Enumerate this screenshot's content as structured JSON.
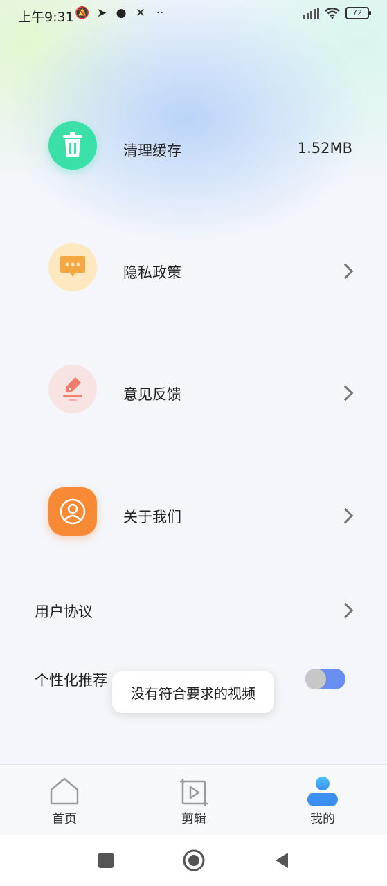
{
  "status_bar": {
    "time": "上午9:31",
    "battery": "72",
    "left_icons": [
      "muted-bell-icon",
      "telegram-icon",
      "chat-bubble-icon",
      "app-icon",
      "more-dots-icon"
    ]
  },
  "menu": {
    "items": [
      {
        "label": "清理缓存",
        "value": "1.52MB",
        "icon": "trash-icon",
        "color": "#3be0a8"
      },
      {
        "label": "隐私政策",
        "icon": "message-dots-icon",
        "color": "#f5a742"
      },
      {
        "label": "意见反馈",
        "icon": "pen-feedback-icon",
        "color": "#f07d6b"
      },
      {
        "label": "关于我们",
        "icon": "user-circle-icon",
        "color": "#f88a36"
      }
    ],
    "user_agreement": "用户协议",
    "personalized": "个性化推荐",
    "personalized_on": true
  },
  "toast": {
    "text": "没有符合要求的视频"
  },
  "tabs": [
    {
      "label": "首页",
      "icon": "home-icon"
    },
    {
      "label": "剪辑",
      "icon": "video-edit-icon"
    },
    {
      "label": "我的",
      "icon": "profile-icon",
      "active": true,
      "accent": "#3a8ff0"
    }
  ],
  "nav": [
    "recent-apps-icon",
    "home-circle-icon",
    "back-triangle-icon"
  ]
}
